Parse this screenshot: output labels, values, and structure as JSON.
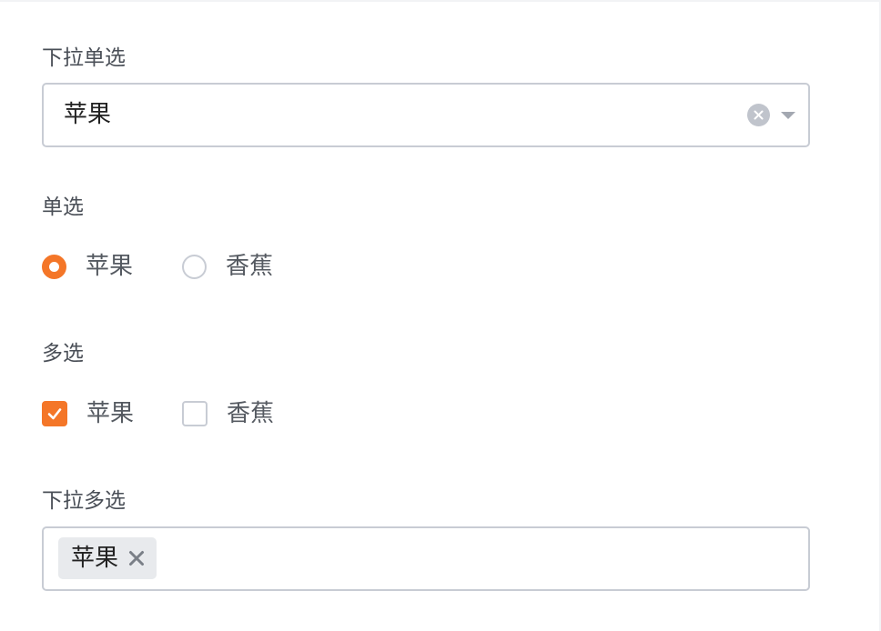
{
  "colors": {
    "accent": "#f47628",
    "border": "#c8ccd4",
    "tag_bg": "#e8eaed",
    "clear_icon": "#c0c4cc"
  },
  "dropdown_single": {
    "label": "下拉单选",
    "selected_value": "苹果",
    "icons": [
      "clear-icon",
      "chevron-down-icon"
    ]
  },
  "radio_group": {
    "label": "单选",
    "options": [
      {
        "label": "苹果",
        "checked": true
      },
      {
        "label": "香蕉",
        "checked": false
      }
    ]
  },
  "checkbox_group": {
    "label": "多选",
    "options": [
      {
        "label": "苹果",
        "checked": true
      },
      {
        "label": "香蕉",
        "checked": false
      }
    ]
  },
  "dropdown_multi": {
    "label": "下拉多选",
    "tags": [
      {
        "label": "苹果",
        "icon": "close-icon"
      }
    ]
  }
}
